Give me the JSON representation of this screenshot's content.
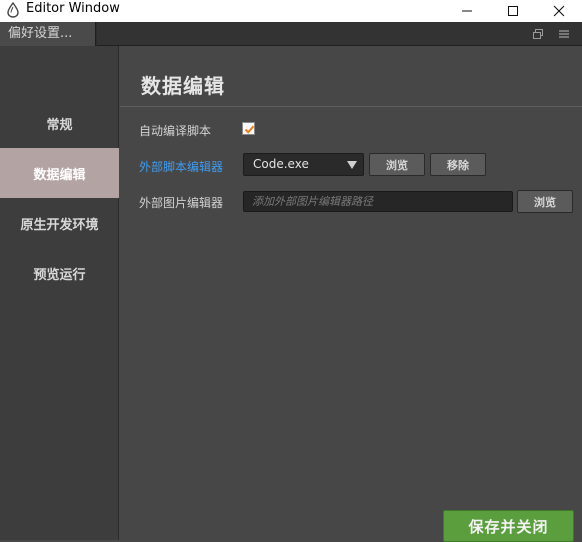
{
  "window": {
    "title": "Editor Window"
  },
  "tab": {
    "label": "偏好设置..."
  },
  "sidebar": {
    "items": [
      {
        "label": "常规",
        "active": false
      },
      {
        "label": "数据编辑",
        "active": true
      },
      {
        "label": "原生开发环境",
        "active": false
      },
      {
        "label": "预览运行",
        "active": false
      }
    ]
  },
  "main": {
    "title": "数据编辑",
    "auto_compile": {
      "label": "自动编译脚本",
      "checked": true
    },
    "script_editor": {
      "label": "外部脚本编辑器",
      "selected": "Code.exe",
      "browse_label": "浏览",
      "remove_label": "移除"
    },
    "image_editor": {
      "label": "外部图片编辑器",
      "placeholder": "添加外部图片编辑器路径",
      "value": "",
      "browse_label": "浏览"
    },
    "save_label": "保存并关闭"
  },
  "colors": {
    "accent_link": "#3f9cf0",
    "checkbox_check": "#f07b1c",
    "save_button": "#5a9e3e",
    "active_sidebar": "#b3a3a3"
  },
  "icons": [
    "app-icon",
    "minimize-icon",
    "maximize-icon",
    "close-icon",
    "popout-icon",
    "menu-icon",
    "chevron-down-icon",
    "checkmark-icon"
  ]
}
